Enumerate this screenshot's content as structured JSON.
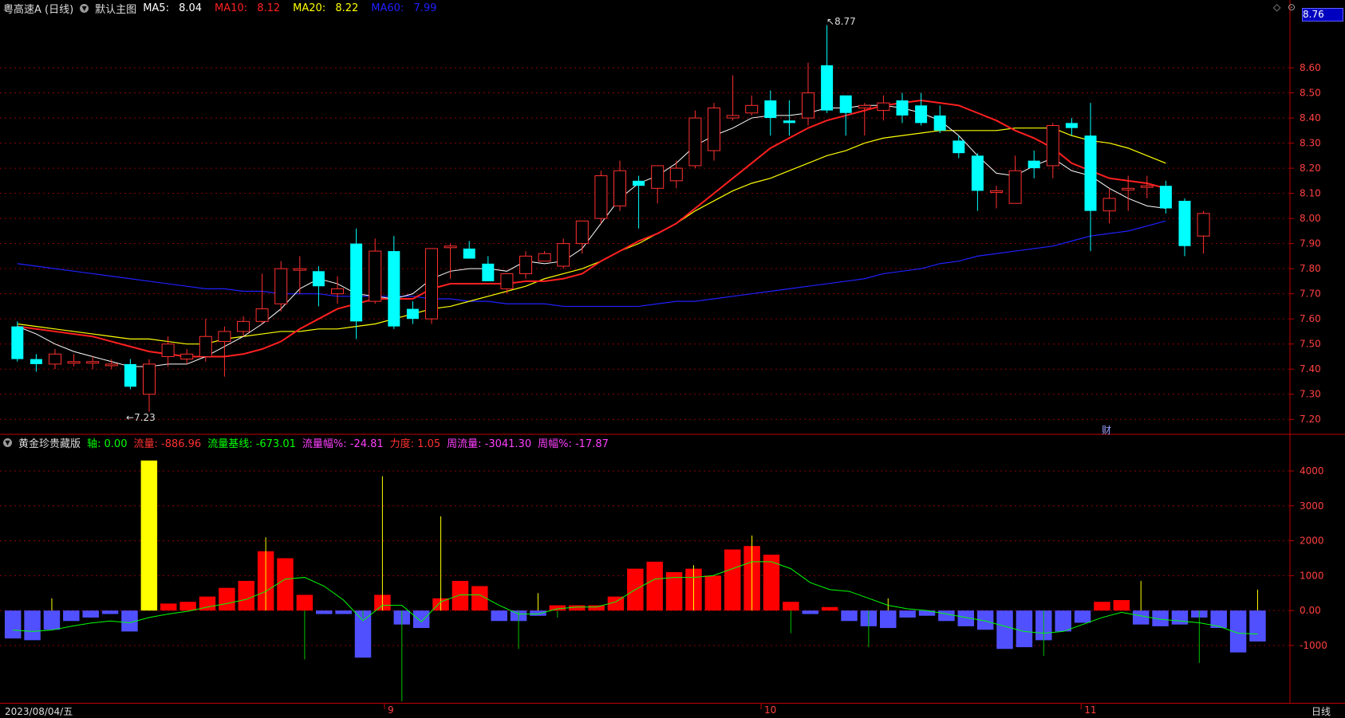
{
  "header": {
    "stock_name": "粤高速A (日线)",
    "main_chart_label": "默认主图",
    "ma5": {
      "label": "MA5:",
      "value": "8.04",
      "color": "#ffffff"
    },
    "ma10": {
      "label": "MA10:",
      "value": "8.12",
      "color": "#ff2020"
    },
    "ma20": {
      "label": "MA20:",
      "value": "8.22",
      "color": "#ffff00"
    },
    "ma60": {
      "label": "MA60:",
      "value": "7.99",
      "color": "#2020ff"
    },
    "current_price_box": "8.76"
  },
  "indicator_header": {
    "name": "黄金珍贵藏版",
    "items": [
      {
        "text": "轴: 0.00",
        "color": "#00ff00"
      },
      {
        "text": "流量: -886.96",
        "color": "#ff3030"
      },
      {
        "text": "流量基线: -673.01",
        "color": "#00ff00"
      },
      {
        "text": "流量幅%: -24.81",
        "color": "#ff40ff"
      },
      {
        "text": "力度: 1.05",
        "color": "#ff3030"
      },
      {
        "text": "周流量: -3041.30",
        "color": "#ff40ff"
      },
      {
        "text": "周幅%: -17.87",
        "color": "#ff40ff"
      }
    ]
  },
  "footer": {
    "date_label": "2023/08/04/五",
    "period_label": "日线",
    "month_ticks": [
      "9",
      "10",
      "11"
    ]
  },
  "annotations": {
    "high_label": "8.77",
    "low_label": "7.23",
    "fin_marker": "财"
  },
  "colors": {
    "up": "#ff3030",
    "down": "#00ffff",
    "grid": "#8b0000",
    "axis": "#c00000",
    "bar_up": "#ff0000",
    "bar_down": "#5050ff",
    "highlight_bar": "#ffff00",
    "baseline": "#00ff00"
  },
  "chart_data": [
    {
      "type": "candlestick",
      "ylim": [
        7.15,
        8.8
      ],
      "yticks": [
        "7.20",
        "7.30",
        "7.40",
        "7.50",
        "7.60",
        "7.70",
        "7.80",
        "7.90",
        "8.00",
        "8.10",
        "8.20",
        "8.30",
        "8.40",
        "8.50",
        "8.60"
      ],
      "ohlc": [
        [
          7.57,
          7.59,
          7.43,
          7.44
        ],
        [
          7.44,
          7.46,
          7.39,
          7.42
        ],
        [
          7.42,
          7.48,
          7.4,
          7.46
        ],
        [
          7.43,
          7.46,
          7.41,
          7.43
        ],
        [
          7.43,
          7.45,
          7.4,
          7.43
        ],
        [
          7.42,
          7.44,
          7.4,
          7.42
        ],
        [
          7.42,
          7.44,
          7.32,
          7.33
        ],
        [
          7.3,
          7.44,
          7.23,
          7.42
        ],
        [
          7.45,
          7.53,
          7.41,
          7.5
        ],
        [
          7.44,
          7.48,
          7.42,
          7.46
        ],
        [
          7.45,
          7.6,
          7.43,
          7.53
        ],
        [
          7.51,
          7.57,
          7.37,
          7.55
        ],
        [
          7.55,
          7.61,
          7.53,
          7.59
        ],
        [
          7.59,
          7.78,
          7.58,
          7.64
        ],
        [
          7.66,
          7.83,
          7.63,
          7.8
        ],
        [
          7.8,
          7.85,
          7.7,
          7.8
        ],
        [
          7.79,
          7.81,
          7.65,
          7.73
        ],
        [
          7.7,
          7.77,
          7.66,
          7.72
        ],
        [
          7.9,
          7.96,
          7.52,
          7.59
        ],
        [
          7.67,
          7.92,
          7.66,
          7.87
        ],
        [
          7.87,
          7.93,
          7.56,
          7.57
        ],
        [
          7.64,
          7.67,
          7.58,
          7.6
        ],
        [
          7.6,
          7.88,
          7.58,
          7.88
        ],
        [
          7.89,
          7.9,
          7.76,
          7.89
        ],
        [
          7.88,
          7.91,
          7.84,
          7.84
        ],
        [
          7.82,
          7.85,
          7.75,
          7.75
        ],
        [
          7.72,
          7.77,
          7.7,
          7.78
        ],
        [
          7.78,
          7.87,
          7.76,
          7.85
        ],
        [
          7.83,
          7.87,
          7.83,
          7.86
        ],
        [
          7.81,
          7.92,
          7.8,
          7.9
        ],
        [
          7.9,
          7.99,
          7.86,
          7.99
        ],
        [
          8.0,
          8.19,
          7.98,
          8.17
        ],
        [
          8.05,
          8.23,
          8.03,
          8.19
        ],
        [
          8.15,
          8.17,
          7.96,
          8.13
        ],
        [
          8.12,
          8.21,
          8.06,
          8.21
        ],
        [
          8.15,
          8.23,
          8.12,
          8.2
        ],
        [
          8.21,
          8.43,
          8.2,
          8.4
        ],
        [
          8.27,
          8.46,
          8.23,
          8.44
        ],
        [
          8.4,
          8.57,
          8.39,
          8.41
        ],
        [
          8.42,
          8.49,
          8.41,
          8.45
        ],
        [
          8.47,
          8.51,
          8.33,
          8.4
        ],
        [
          8.39,
          8.47,
          8.33,
          8.38
        ],
        [
          8.4,
          8.62,
          8.37,
          8.5
        ],
        [
          8.61,
          8.77,
          8.42,
          8.43
        ],
        [
          8.49,
          8.44,
          8.33,
          8.42
        ],
        [
          8.44,
          8.46,
          8.33,
          8.45
        ],
        [
          8.43,
          8.49,
          8.39,
          8.46
        ],
        [
          8.47,
          8.5,
          8.38,
          8.41
        ],
        [
          8.45,
          8.5,
          8.37,
          8.38
        ],
        [
          8.41,
          8.45,
          8.34,
          8.35
        ],
        [
          8.31,
          8.33,
          8.24,
          8.26
        ],
        [
          8.25,
          8.26,
          8.03,
          8.11
        ],
        [
          8.11,
          8.13,
          8.04,
          8.11
        ],
        [
          8.06,
          8.25,
          8.06,
          8.19
        ],
        [
          8.23,
          8.27,
          8.16,
          8.2
        ],
        [
          8.21,
          8.38,
          8.16,
          8.37
        ],
        [
          8.38,
          8.4,
          8.33,
          8.36
        ],
        [
          8.33,
          8.46,
          7.87,
          8.03
        ],
        [
          8.03,
          8.12,
          7.98,
          8.08
        ],
        [
          8.12,
          8.17,
          8.03,
          8.12
        ],
        [
          8.13,
          8.17,
          8.08,
          8.13
        ],
        [
          8.13,
          8.15,
          8.02,
          8.04
        ],
        [
          8.07,
          8.08,
          7.85,
          7.89
        ],
        [
          7.93,
          8.03,
          7.86,
          8.02
        ]
      ],
      "ma5": [
        7.57,
        7.54,
        7.5,
        7.47,
        7.45,
        7.43,
        7.41,
        7.41,
        7.42,
        7.42,
        7.45,
        7.49,
        7.53,
        7.58,
        7.64,
        7.72,
        7.76,
        7.74,
        7.7,
        7.69,
        7.68,
        7.7,
        7.76,
        7.79,
        7.8,
        7.8,
        7.79,
        7.83,
        7.82,
        7.83,
        7.88,
        7.98,
        8.08,
        8.14,
        8.17,
        8.22,
        8.29,
        8.33,
        8.36,
        8.4,
        8.41,
        8.41,
        8.42,
        8.44,
        8.44,
        8.45,
        8.45,
        8.44,
        8.42,
        8.39,
        8.33,
        8.25,
        8.18,
        8.17,
        8.21,
        8.24,
        8.19,
        8.17,
        8.12,
        8.08,
        8.05,
        8.04
      ],
      "ma10": [
        7.57,
        7.56,
        7.55,
        7.54,
        7.53,
        7.51,
        7.49,
        7.47,
        7.46,
        7.45,
        7.45,
        7.45,
        7.46,
        7.48,
        7.51,
        7.56,
        7.6,
        7.64,
        7.66,
        7.68,
        7.68,
        7.68,
        7.72,
        7.74,
        7.74,
        7.74,
        7.74,
        7.75,
        7.75,
        7.76,
        7.78,
        7.83,
        7.87,
        7.91,
        7.94,
        7.98,
        8.04,
        8.1,
        8.16,
        8.22,
        8.28,
        8.32,
        8.36,
        8.39,
        8.41,
        8.43,
        8.45,
        8.46,
        8.47,
        8.46,
        8.45,
        8.42,
        8.39,
        8.35,
        8.32,
        8.28,
        8.22,
        8.19,
        8.16,
        8.15,
        8.14,
        8.12
      ],
      "ma20": [
        7.58,
        7.57,
        7.56,
        7.55,
        7.54,
        7.53,
        7.52,
        7.52,
        7.51,
        7.5,
        7.5,
        7.52,
        7.53,
        7.54,
        7.55,
        7.55,
        7.56,
        7.56,
        7.57,
        7.58,
        7.6,
        7.62,
        7.64,
        7.65,
        7.67,
        7.69,
        7.71,
        7.73,
        7.76,
        7.78,
        7.8,
        7.83,
        7.87,
        7.9,
        7.94,
        7.98,
        8.03,
        8.07,
        8.11,
        8.14,
        8.16,
        8.19,
        8.22,
        8.25,
        8.27,
        8.3,
        8.32,
        8.33,
        8.34,
        8.35,
        8.35,
        8.35,
        8.35,
        8.36,
        8.36,
        8.36,
        8.33,
        8.31,
        8.3,
        8.28,
        8.25,
        8.22
      ],
      "ma60": [
        7.82,
        7.81,
        7.8,
        7.79,
        7.78,
        7.77,
        7.76,
        7.75,
        7.74,
        7.73,
        7.72,
        7.72,
        7.71,
        7.71,
        7.7,
        7.7,
        7.7,
        7.69,
        7.69,
        7.69,
        7.69,
        7.69,
        7.68,
        7.68,
        7.67,
        7.67,
        7.66,
        7.66,
        7.66,
        7.65,
        7.65,
        7.65,
        7.65,
        7.65,
        7.66,
        7.67,
        7.67,
        7.68,
        7.69,
        7.7,
        7.71,
        7.72,
        7.73,
        7.74,
        7.75,
        7.76,
        7.78,
        7.79,
        7.8,
        7.82,
        7.83,
        7.85,
        7.86,
        7.87,
        7.88,
        7.89,
        7.91,
        7.93,
        7.94,
        7.95,
        7.97,
        7.99
      ]
    },
    {
      "type": "bar",
      "ylim": [
        -2600,
        4800
      ],
      "yticks": [
        "4000",
        "3000",
        "2000",
        "1000",
        "0.00",
        "-1000"
      ],
      "values": [
        -800,
        -850,
        -550,
        -300,
        -200,
        -100,
        -600,
        4300,
        200,
        250,
        400,
        650,
        850,
        1700,
        1500,
        450,
        -100,
        -100,
        -1350,
        450,
        -400,
        -500,
        350,
        850,
        700,
        -300,
        -300,
        -150,
        150,
        150,
        150,
        400,
        1200,
        1400,
        1100,
        1200,
        1000,
        1750,
        1850,
        1600,
        250,
        -100,
        100,
        -300,
        -450,
        -500,
        -200,
        -150,
        -300,
        -450,
        -550,
        -1100,
        -1050,
        -850,
        -600,
        -350,
        250,
        300,
        -400,
        -450,
        -400,
        -200,
        -500,
        -1200,
        -887
      ],
      "highlight_index": 7,
      "spikes": [
        [
          2,
          350
        ],
        [
          13,
          2100
        ],
        [
          15,
          -1400
        ],
        [
          18,
          -200
        ],
        [
          19,
          3850
        ],
        [
          20,
          -2600
        ],
        [
          22,
          2700
        ],
        [
          26,
          -1100
        ],
        [
          27,
          500
        ],
        [
          28,
          -200
        ],
        [
          35,
          1300
        ],
        [
          38,
          2150
        ],
        [
          40,
          -650
        ],
        [
          44,
          -1050
        ],
        [
          45,
          350
        ],
        [
          53,
          -1300
        ],
        [
          58,
          850
        ],
        [
          61,
          -1500
        ],
        [
          64,
          600
        ]
      ],
      "baseline": [
        -560,
        -600,
        -560,
        -450,
        -360,
        -300,
        -350,
        -200,
        -100,
        -20,
        100,
        200,
        320,
        550,
        900,
        950,
        700,
        300,
        -290,
        150,
        150,
        -320,
        250,
        450,
        450,
        150,
        -100,
        -100,
        50,
        100,
        100,
        250,
        600,
        900,
        950,
        950,
        1000,
        1200,
        1400,
        1400,
        1200,
        800,
        600,
        550,
        350,
        150,
        50,
        0,
        -100,
        -200,
        -300,
        -450,
        -600,
        -650,
        -600,
        -400,
        -200,
        -50,
        -150,
        -250,
        -300,
        -350,
        -450,
        -650,
        -673
      ]
    }
  ]
}
